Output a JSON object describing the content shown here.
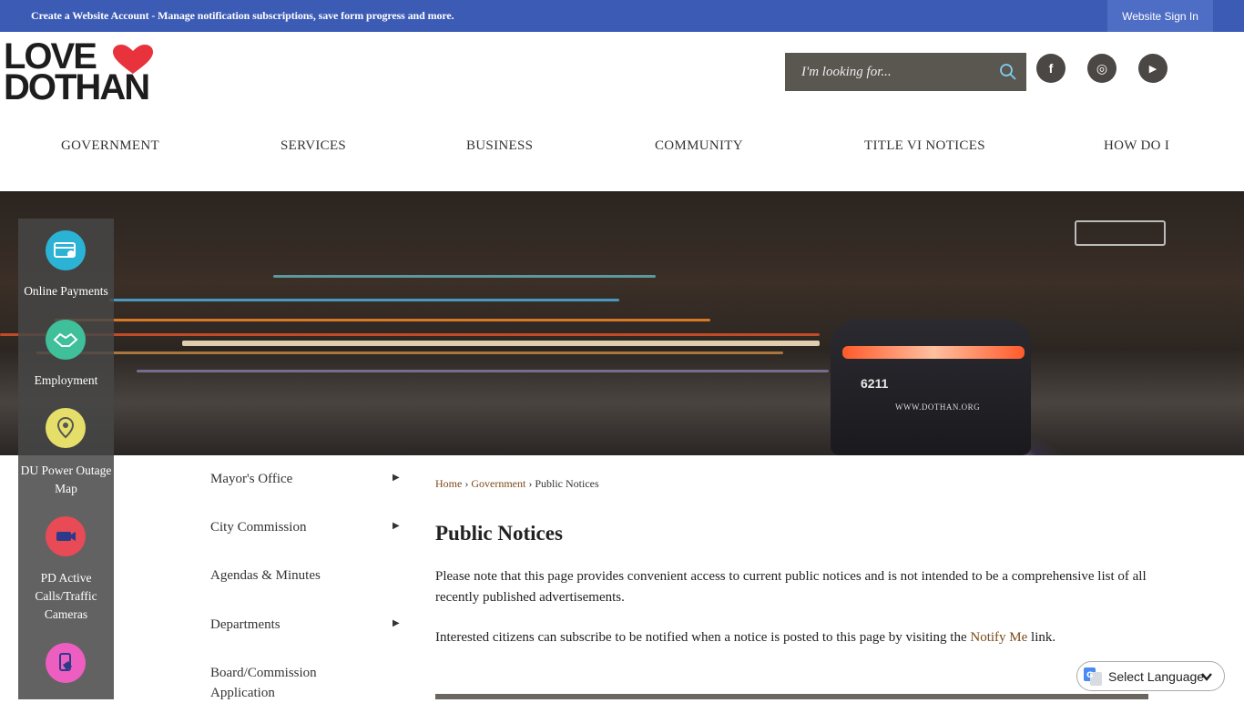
{
  "topbar": {
    "message": "Create a Website Account - Manage notification subscriptions, save form progress and more.",
    "signin_label": "Website Sign In"
  },
  "logo": {
    "line1": "LOVE",
    "line2": "DOTHAN",
    "heart_color": "#e8323c"
  },
  "search": {
    "placeholder": "I'm looking for..."
  },
  "social": [
    {
      "icon": "facebook-icon",
      "glyph": "f"
    },
    {
      "icon": "instagram-icon",
      "glyph": "◎"
    },
    {
      "icon": "youtube-icon",
      "glyph": "▶"
    }
  ],
  "nav": [
    "GOVERNMENT",
    "SERVICES",
    "BUSINESS",
    "COMMUNITY",
    "TITLE VI NOTICES",
    "HOW DO I"
  ],
  "hero": {
    "car_number": "6211",
    "car_url": "WWW.DOTHAN.ORG"
  },
  "quick_links": [
    {
      "label": "Online Payments",
      "icon": "credit-card-icon",
      "color": "#2bb3d6"
    },
    {
      "label": "Employment",
      "icon": "handshake-icon",
      "color": "#3fbf9a"
    },
    {
      "label": "DU Power Outage Map",
      "icon": "map-pin-icon",
      "color": "#e5df6a"
    },
    {
      "label": "PD Active Calls/Traffic Cameras",
      "icon": "camera-icon",
      "color": "#e84a56"
    },
    {
      "label": "",
      "icon": "phone-hand-icon",
      "color": "#ee5ec0"
    }
  ],
  "subnav": [
    {
      "label": "Mayor's Office",
      "has_arrow": true
    },
    {
      "label": "City Commission",
      "has_arrow": true
    },
    {
      "label": "Agendas & Minutes",
      "has_arrow": false
    },
    {
      "label": "Departments",
      "has_arrow": true
    },
    {
      "label": "Board/Commission Application",
      "has_arrow": false
    }
  ],
  "breadcrumb": {
    "home": "Home",
    "sep": "›",
    "government": "Government",
    "current": "Public Notices"
  },
  "page": {
    "title": "Public Notices",
    "para1": "Please note that this page provides convenient access to current public notices and is not intended to be a comprehensive list of all recently published advertisements.",
    "para2_before": "Interested citizens can subscribe to be notified when a notice is posted to this page by visiting the ",
    "para2_link": "Notify Me",
    "para2_after": " link."
  },
  "language": {
    "label": "Select Language"
  },
  "colors": {
    "topbar": "#3b5bb5",
    "link": "#7a4a18",
    "search_bg": "#5a5650"
  }
}
